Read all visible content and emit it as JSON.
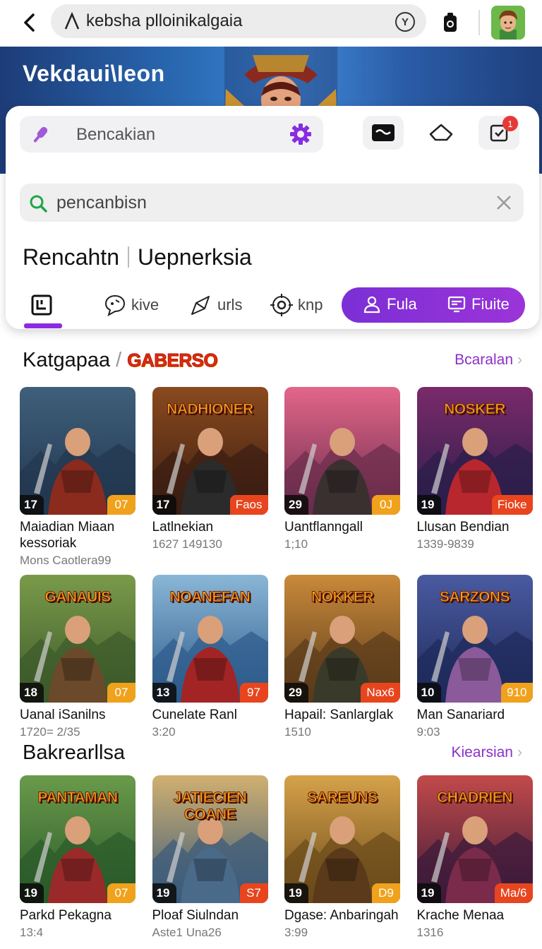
{
  "browser": {
    "url": "kebsha plloinikalgaia",
    "y_button": "Y"
  },
  "hero": {
    "title": "Vekdaui\\Ieon"
  },
  "card": {
    "voice_placeholder": "Bencakian",
    "notification_count": "1",
    "search_placeholder": "pencanbisn",
    "title_left": "Rencahtn",
    "title_right": "Uepnerksia",
    "tabs": [
      {
        "label": ""
      },
      {
        "label": "kive"
      },
      {
        "label": "urls"
      },
      {
        "label": "knp"
      }
    ],
    "pill_left": "Fula",
    "pill_right": "Fiuite"
  },
  "section1": {
    "title": "Katgapaa",
    "tag": "GABERSO",
    "see_all": "Bcaralan",
    "row1": [
      {
        "num": "17",
        "badge": "07",
        "badge_color": "#f0a21c",
        "logo": "",
        "title": "Maiadian Miaan kessoriak",
        "sub": "Mons Caotlera99"
      },
      {
        "num": "17",
        "badge": "Faos",
        "badge_color": "#e8451e",
        "logo": "NADHIONER",
        "title": "Latlnekian",
        "sub": "1627 149130"
      },
      {
        "num": "29",
        "badge": "0J",
        "badge_color": "#f0a21c",
        "logo": "",
        "title": "Uantflanngall",
        "sub": "1;10"
      },
      {
        "num": "19",
        "badge": "Fioke",
        "badge_color": "#e8451e",
        "logo": "NOSKER",
        "title": "Llusan Bendian",
        "sub": "1339-9839"
      }
    ],
    "row2": [
      {
        "num": "18",
        "badge": "07",
        "badge_color": "#f0a21c",
        "logo": "GANAUIS",
        "title": "Uanal iSanilns",
        "sub": "1720= 2/35"
      },
      {
        "num": "13",
        "badge": "97",
        "badge_color": "#e8451e",
        "logo": "NOANEFAN",
        "title": "Cunelate Ranl",
        "sub": "3:20"
      },
      {
        "num": "29",
        "badge": "Nax6",
        "badge_color": "#e8451e",
        "logo": "NOKKER",
        "title": "Hapail: Sanlarglak",
        "sub": "1510"
      },
      {
        "num": "10",
        "badge": "910",
        "badge_color": "#f0a21c",
        "logo": "SARZONS",
        "title": "Man Sanariard",
        "sub": "9:03"
      }
    ]
  },
  "section2": {
    "title": "Bakrearllsa",
    "see_all": "Kiearsian",
    "row": [
      {
        "num": "19",
        "badge": "07",
        "badge_color": "#f0a21c",
        "logo": "PANTAMAN",
        "title": "Parkd Pekagna",
        "sub": "13:4"
      },
      {
        "num": "19",
        "badge": "S7",
        "badge_color": "#e8451e",
        "logo": "JATIECIEN COANE",
        "title": "Ploaf Siulndan",
        "sub": "Aste1 Una26"
      },
      {
        "num": "19",
        "badge": "D9",
        "badge_color": "#f0a21c",
        "logo": "SAREUNS",
        "title": "Dgase: Anbaringah",
        "sub": "3:99"
      },
      {
        "num": "19",
        "badge": "Ma/6",
        "badge_color": "#e8451e",
        "logo": "CHADRIEN",
        "title": "Krache Menaa",
        "sub": "1316"
      }
    ]
  },
  "colors": {
    "accent": "#8a2be2",
    "orange_badge": "#f0a21c",
    "red_badge": "#e8451e"
  }
}
